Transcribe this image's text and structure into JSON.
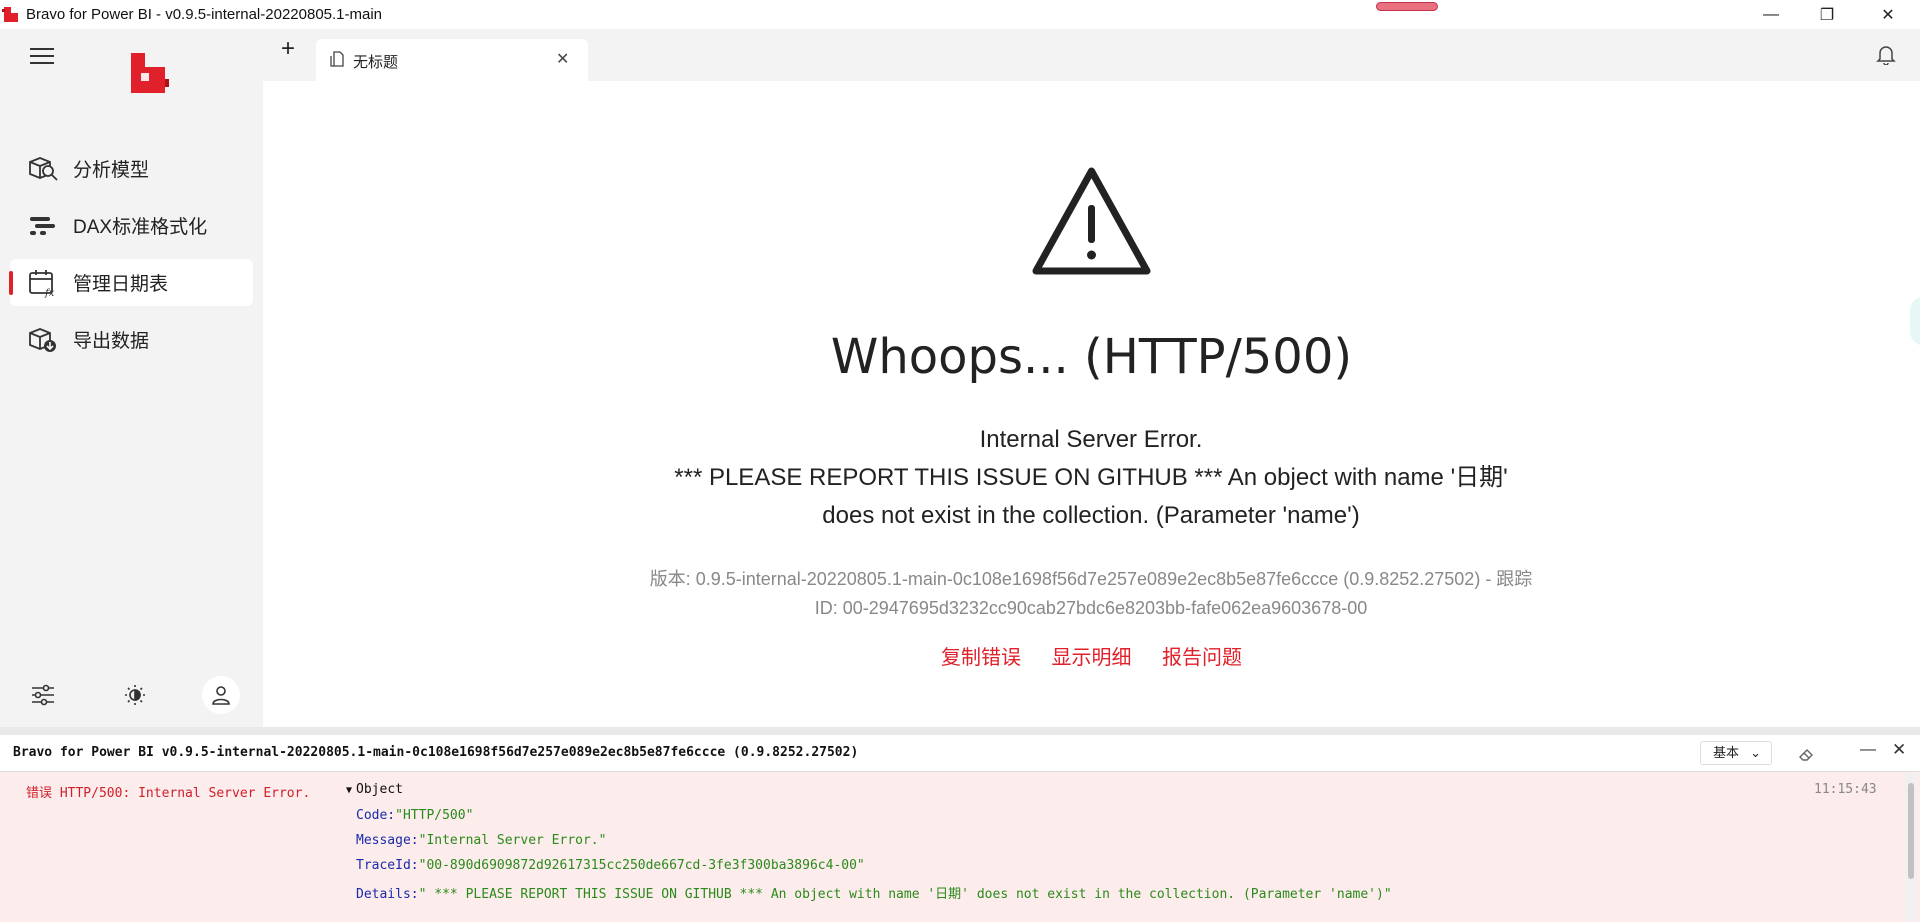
{
  "window": {
    "title": "Bravo for Power BI - v0.9.5-internal-20220805.1-main",
    "minimize_icon": "—",
    "maximize_icon": "❐",
    "close_icon": "✕"
  },
  "sidebar": {
    "items": [
      {
        "label": "分析模型",
        "icon": "analyze-model-icon",
        "active": false
      },
      {
        "label": "DAX标准格式化",
        "icon": "format-dax-icon",
        "active": false
      },
      {
        "label": "管理日期表",
        "icon": "manage-dates-icon",
        "active": true
      },
      {
        "label": "导出数据",
        "icon": "export-data-icon",
        "active": false
      }
    ]
  },
  "tabs": {
    "new_tab_label": "+",
    "items": [
      {
        "label": "无标题",
        "close": "✕"
      }
    ]
  },
  "error": {
    "title": "Whoops... (HTTP/500)",
    "message_line1": "Internal Server Error.",
    "message_line2": "*** PLEASE REPORT THIS ISSUE ON GITHUB *** An object with name '日期' does not exist in the collection. (Parameter 'name')",
    "version_line": "版本: 0.9.5-internal-20220805.1-main-0c108e1698f56d7e257e089e2ec8b5e87fe6ccce (0.9.8252.27502) - 跟踪ID: 00-2947695d3232cc90cab27bdc6e8203bb-fafe062ea9603678-00",
    "actions": {
      "copy": "复制错误",
      "details": "显示明细",
      "report": "报告问题"
    }
  },
  "console": {
    "title": "Bravo for Power BI v0.9.5-internal-20220805.1-main-0c108e1698f56d7e257e089e2ec8b5e87fe6ccce (0.9.8252.27502)",
    "level": "基本",
    "minimize": "—",
    "close": "✕",
    "log": {
      "prefix": "错误 HTTP/500: Internal Server Error.",
      "object_label": "Object",
      "time": "11:15:43",
      "props": [
        {
          "key": "Code:",
          "value": "\"HTTP/500\""
        },
        {
          "key": "Message:",
          "value": "\"Internal Server Error.\""
        },
        {
          "key": "TraceId:",
          "value": "\"00-890d6909872d92617315cc250de667cd-3fe3f300ba3896c4-00\""
        },
        {
          "key": "Details:",
          "value": "\" *** PLEASE REPORT THIS ISSUE ON GITHUB *** An object with name '日期' does not exist in the collection. (Parameter 'name')\""
        }
      ]
    }
  },
  "colors": {
    "accent": "#e0202a",
    "sidebar_bg": "#f3f3f3",
    "console_error_bg": "#fdecec"
  }
}
